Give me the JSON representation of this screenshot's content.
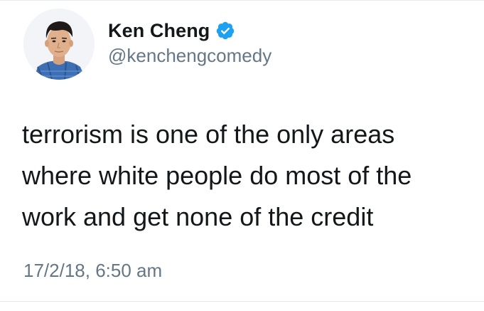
{
  "tweet": {
    "author": {
      "name": "Ken Cheng",
      "handle": "@kenchengcomedy",
      "verified": true,
      "avatar_icon": "profile-photo",
      "verified_icon": "verified-badge-icon"
    },
    "text_lines": [
      "terrorism is one of the only areas",
      "where white people do most of the",
      "work and get none of the credit"
    ],
    "timestamp": "17/2/18, 6:50 am"
  },
  "colors": {
    "text_primary": "#14171a",
    "text_secondary": "#657786",
    "verified_blue": "#1da1f2",
    "divider": "#e6ecf0"
  }
}
